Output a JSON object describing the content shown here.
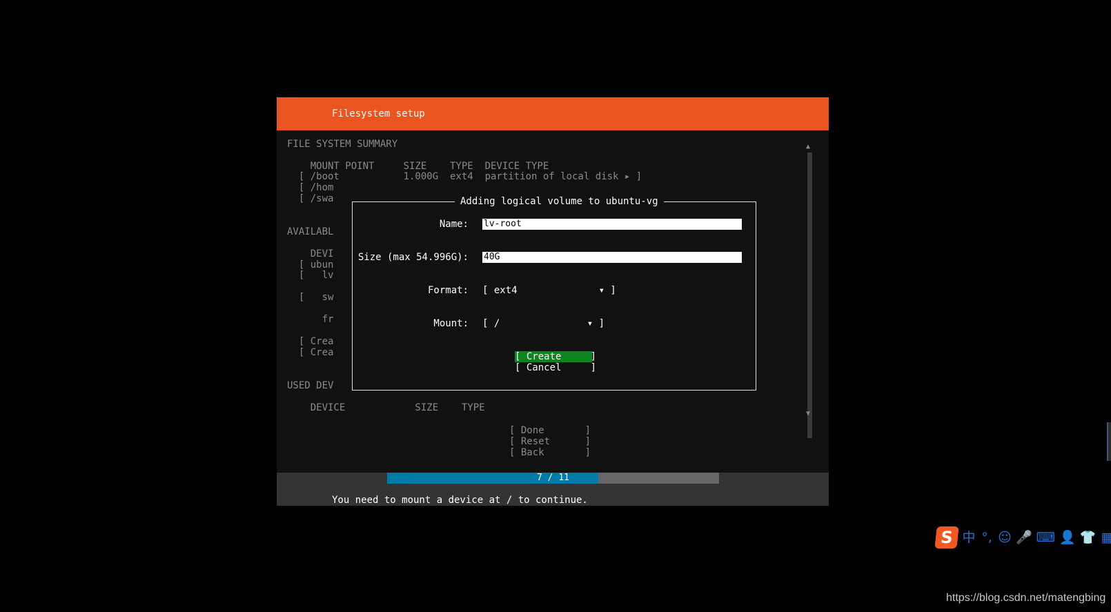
{
  "header": {
    "title": "Filesystem setup"
  },
  "background": {
    "lines": [
      "FILE SYSTEM SUMMARY",
      "    MOUNT POINT     SIZE    TYPE  DEVICE TYPE",
      "  [ /boot           1.000G  ext4  partition of local disk ▸ ]",
      "  [ /hom",
      "  [ /swa",
      "AVAILABL",
      "    DEVI",
      "  [ ubun",
      "  [   lv",
      "  [   sw",
      "      fr",
      "  [ Crea",
      "  [ Crea",
      "USED DEV",
      "    DEVICE            SIZE    TYPE"
    ],
    "scroll_up": "▲",
    "scroll_down": "▼",
    "actions": [
      "[ Done       ]",
      "[ Reset      ]",
      "[ Back       ]"
    ]
  },
  "dialog": {
    "title": "Adding logical volume to ubuntu-vg",
    "name_label": "Name:",
    "name_value": "lv-root",
    "size_label": "Size (max 54.996G):",
    "size_value": "40G",
    "format_label": "Format:",
    "format_value": "[ ext4              ▾ ]",
    "mount_label": "Mount:",
    "mount_value": "[ /               ▾ ]",
    "create_label": "[ Create     ]",
    "cancel_label": "[ Cancel     ]"
  },
  "footer": {
    "progress_text": "7 / 11",
    "progress_current": 7,
    "progress_total": 11,
    "message": "You need to mount a device at / to continue."
  },
  "ime": {
    "logo": "S",
    "items": [
      "中",
      "°,",
      "☺",
      "🎤",
      "⌨",
      "👤",
      "👕",
      "▦"
    ]
  },
  "watermark": "https://blog.csdn.net/matengbing",
  "colors": {
    "header": "#e95420",
    "focus": "#0e8420",
    "progress_fill": "#007aa6",
    "ime_accent": "#2a6fd8"
  }
}
